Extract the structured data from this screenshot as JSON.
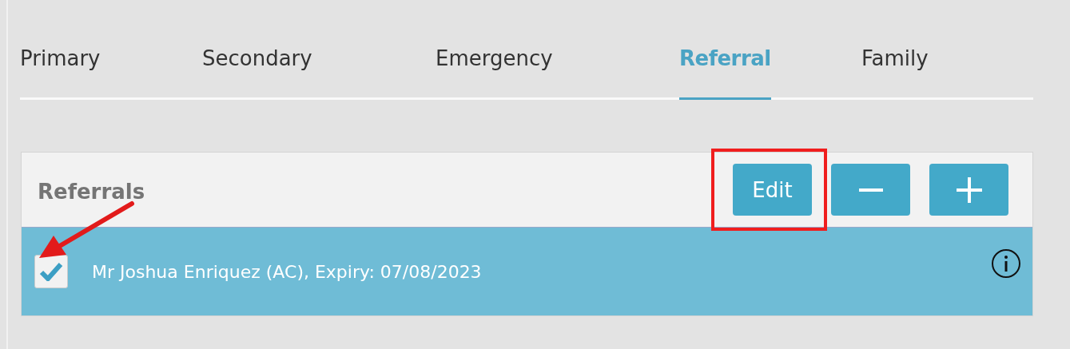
{
  "tabs": [
    {
      "label": "Primary",
      "selected": false
    },
    {
      "label": "Secondary",
      "selected": false
    },
    {
      "label": "Emergency",
      "selected": false
    },
    {
      "label": "Referral",
      "selected": true
    },
    {
      "label": "Family",
      "selected": false
    }
  ],
  "panel": {
    "title": "Referrals",
    "buttons": [
      {
        "kind": "text",
        "label": "Edit",
        "highlighted": true
      },
      {
        "kind": "minus",
        "highlighted": false
      },
      {
        "kind": "plus",
        "highlighted": false
      }
    ]
  },
  "rows": [
    {
      "text": "Mr Joshua Enriquez (AC), Expiry: 07/08/2023",
      "checked": true,
      "selected": true,
      "arrow": true
    }
  ]
}
